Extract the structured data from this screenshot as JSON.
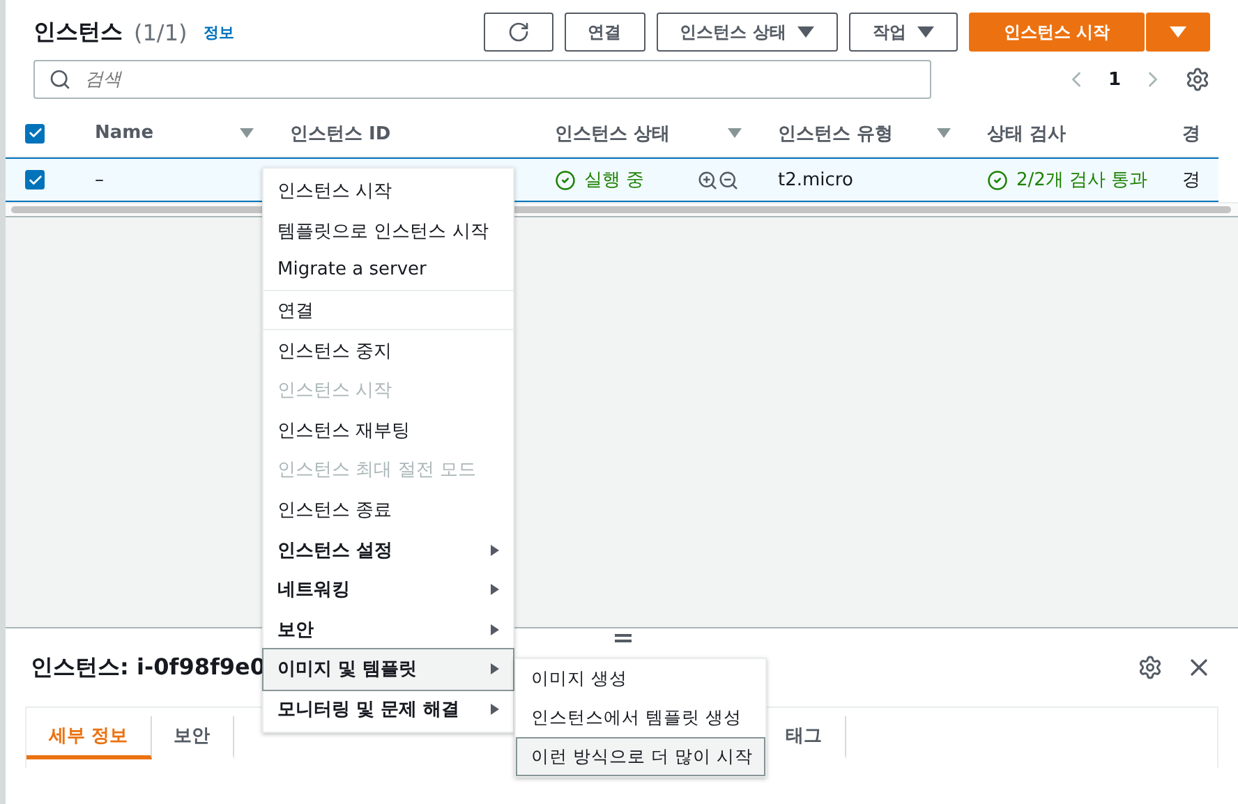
{
  "header": {
    "title": "인스턴스",
    "count": "(1/1)",
    "info_link": "정보"
  },
  "toolbar": {
    "buttons": [
      {
        "kind": "icon"
      },
      {
        "kind": "plain",
        "label": "연결"
      },
      {
        "kind": "dropdown",
        "label": "인스턴스 상태"
      },
      {
        "kind": "dropdown",
        "label": "작업"
      },
      {
        "kind": "primary",
        "label": "인스턴스 시작"
      },
      {
        "kind": "primary-caret"
      }
    ]
  },
  "search": {
    "placeholder": "검색"
  },
  "pagination": {
    "page": "1"
  },
  "table": {
    "all_checked": true,
    "columns": [
      {
        "label": "Name",
        "filter": true
      },
      {
        "label": "인스턴스 ID",
        "filter": false
      },
      {
        "label": "인스턴스 상태",
        "filter": true
      },
      {
        "label": "인스턴스 유형",
        "filter": true
      },
      {
        "label": "상태 검사",
        "filter": false
      },
      {
        "label": "경",
        "filter": false
      }
    ],
    "rows": [
      {
        "checked": true,
        "selected": true,
        "name": "–",
        "status": "실행 중",
        "type": "t2.micro",
        "check": "2/2개 검사 통과",
        "column_6": "경"
      }
    ]
  },
  "context_menu": {
    "items": [
      {
        "label": "인스턴스 시작",
        "disabled": false,
        "submenu": false,
        "divider_after": false,
        "selected": false
      },
      {
        "label": "템플릿으로 인스턴스 시작",
        "disabled": false,
        "submenu": false,
        "divider_after": false,
        "selected": false
      },
      {
        "label": "Migrate a server",
        "disabled": false,
        "submenu": false,
        "divider_after": true,
        "selected": false
      },
      {
        "label": "연결",
        "disabled": false,
        "submenu": false,
        "divider_after": true,
        "selected": false
      },
      {
        "label": "인스턴스 중지",
        "disabled": false,
        "submenu": false,
        "divider_after": false,
        "selected": false
      },
      {
        "label": "인스턴스 시작",
        "disabled": true,
        "submenu": false,
        "divider_after": false,
        "selected": false
      },
      {
        "label": "인스턴스 재부팅",
        "disabled": false,
        "submenu": false,
        "divider_after": false,
        "selected": false
      },
      {
        "label": "인스턴스 최대 절전 모드",
        "disabled": true,
        "submenu": false,
        "divider_after": false,
        "selected": false
      },
      {
        "label": "인스턴스 종료",
        "disabled": false,
        "submenu": false,
        "divider_after": false,
        "selected": false
      },
      {
        "label": "인스턴스 설정",
        "disabled": false,
        "submenu": true,
        "divider_after": false,
        "selected": false
      },
      {
        "label": "네트워킹",
        "disabled": false,
        "submenu": true,
        "divider_after": false,
        "selected": false
      },
      {
        "label": "보안",
        "disabled": false,
        "submenu": true,
        "divider_after": false,
        "selected": false
      },
      {
        "label": "이미지 및 템플릿",
        "disabled": false,
        "submenu": true,
        "divider_after": false,
        "selected": true
      },
      {
        "label": "모니터링 및 문제 해결",
        "disabled": false,
        "submenu": true,
        "divider_after": false,
        "selected": false
      }
    ]
  },
  "submenu": {
    "items": [
      {
        "label": "이미지 생성",
        "selected": false
      },
      {
        "label": "인스턴스에서 템플릿 생성",
        "selected": false
      },
      {
        "label": "이런 방식으로 더 많이 시작",
        "selected": true
      }
    ]
  },
  "details": {
    "title": "인스턴스: i-0f98f9e0",
    "tabs": [
      {
        "label": "세부 정보",
        "selected": true
      },
      {
        "label": "보안",
        "selected": false
      },
      {
        "label": "태그",
        "selected": false
      }
    ]
  }
}
